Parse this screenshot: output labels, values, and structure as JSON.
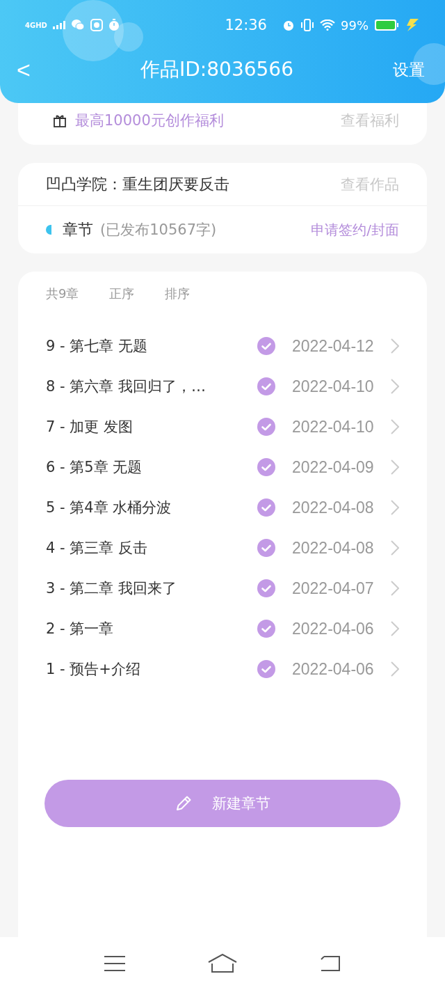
{
  "status_bar": {
    "network": "4GHD",
    "time": "12:36",
    "battery": "99%"
  },
  "header": {
    "back": "<",
    "title": "作品ID:8036566",
    "action": "设置"
  },
  "benefit": {
    "text": "最高10000元创作福利",
    "link": "查看福利"
  },
  "work": {
    "title": "凹凸学院：重生团厌要反击",
    "link": "查看作品",
    "section": "章节",
    "published_count": "(已发布10567字)",
    "sign_link": "申请签约/封面"
  },
  "toolbar": {
    "count": "共9章",
    "options": [
      "正序",
      "排序"
    ]
  },
  "chapters": [
    {
      "title": "9 - 第七章  无题",
      "published": true,
      "date": "2022-04-12"
    },
    {
      "title": "8 - 第六章  我回归了，…",
      "published": true,
      "date": "2022-04-10"
    },
    {
      "title": "7 - 加更  发图",
      "published": true,
      "date": "2022-04-10"
    },
    {
      "title": "6 - 第5章 无题",
      "published": true,
      "date": "2022-04-09"
    },
    {
      "title": "5 - 第4章  水桶分波",
      "published": true,
      "date": "2022-04-08"
    },
    {
      "title": "4 - 第三章  反击",
      "published": true,
      "date": "2022-04-08"
    },
    {
      "title": "3 - 第二章 我回来了",
      "published": true,
      "date": "2022-04-07"
    },
    {
      "title": "2 - 第一章",
      "published": true,
      "date": "2022-04-06"
    },
    {
      "title": "1 - 预告+介绍",
      "published": true,
      "date": "2022-04-06"
    }
  ],
  "new_chapter_button": "新建章节"
}
